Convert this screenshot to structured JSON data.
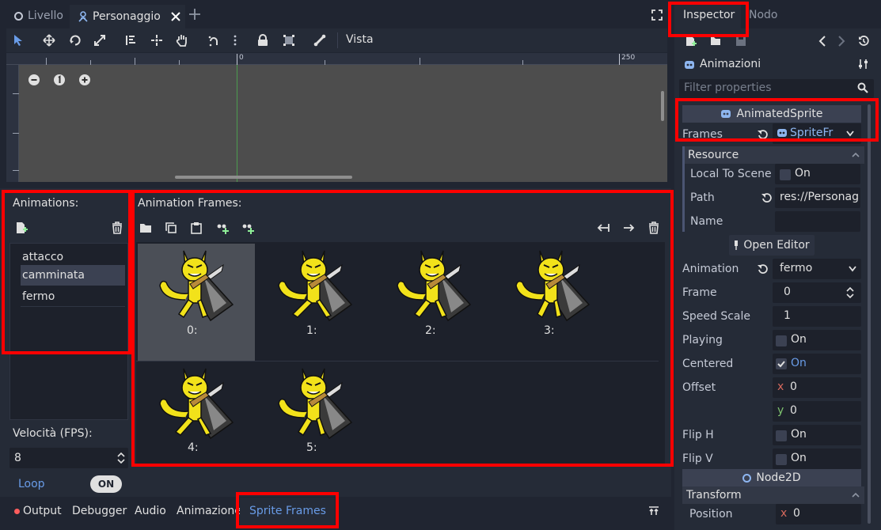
{
  "scene_tabs": [
    {
      "label": "Livello"
    },
    {
      "label": "Personaggio"
    }
  ],
  "toolbar": {
    "vista_label": "Vista"
  },
  "ruler": {
    "mark_0": "0",
    "mark_250": "250"
  },
  "animations_panel": {
    "title": "Animations:",
    "items": [
      "attacco",
      "camminata",
      "fermo"
    ],
    "selected": "camminata",
    "fps_label": "Velocità (FPS):",
    "fps_value": "8",
    "loop_label": "Loop",
    "loop_toggle": "ON"
  },
  "frames_panel": {
    "title": "Animation Frames:",
    "frames": [
      "0:",
      "1:",
      "2:",
      "3:",
      "4:",
      "5:"
    ]
  },
  "bottom_tabs": [
    "Output",
    "Debugger",
    "Audio",
    "Animazione",
    "Sprite Frames"
  ],
  "inspector": {
    "tab_inspector": "Inspector",
    "tab_nodo": "Nodo",
    "object_name": "Animazioni",
    "filter_placeholder": "Filter properties",
    "section_animatedsprite": "AnimatedSprite",
    "frames_label": "Frames",
    "frames_value": "SpriteFr",
    "resource_label": "Resource",
    "local_to_scene_label": "Local To Scene",
    "local_to_scene_value": "On",
    "path_label": "Path",
    "path_value": "res://Personag",
    "name_label": "Name",
    "open_editor": "Open Editor",
    "animation_label": "Animation",
    "animation_value": "fermo",
    "frame_label": "Frame",
    "frame_value": "0",
    "speed_scale_label": "Speed Scale",
    "speed_scale_value": "1",
    "playing_label": "Playing",
    "playing_value": "On",
    "centered_label": "Centered",
    "centered_value": "On",
    "offset_label": "Offset",
    "offset_x_axis": "x",
    "offset_x": "0",
    "offset_y_axis": "y",
    "offset_y": "0",
    "flip_h_label": "Flip H",
    "flip_h_value": "On",
    "flip_v_label": "Flip V",
    "flip_v_value": "On",
    "node2d_label": "Node2D",
    "transform_label": "Transform",
    "position_label": "Position",
    "position_x_axis": "x",
    "position_x": "0"
  },
  "colors": {
    "background": "#202531",
    "panel": "#252b37",
    "accent": "#699ce8",
    "highlight_box": "#ff0000",
    "sprite_yellow": "#f2e21a"
  },
  "icons": [
    "select-icon",
    "move-icon",
    "rotate-icon",
    "scale-icon",
    "list-icon",
    "pivot-icon",
    "pan-icon",
    "snap-icon",
    "lock-icon",
    "group-icon",
    "bone-icon",
    "zoom-out-icon",
    "zoom-reset-icon",
    "zoom-in-icon",
    "new-animation-icon",
    "delete-icon",
    "load-icon",
    "copy-icon",
    "paste-icon",
    "insert-before-icon",
    "insert-after-icon",
    "move-left-icon",
    "move-right-icon",
    "undo-icon",
    "history-icon",
    "search-icon",
    "pin-icon"
  ]
}
